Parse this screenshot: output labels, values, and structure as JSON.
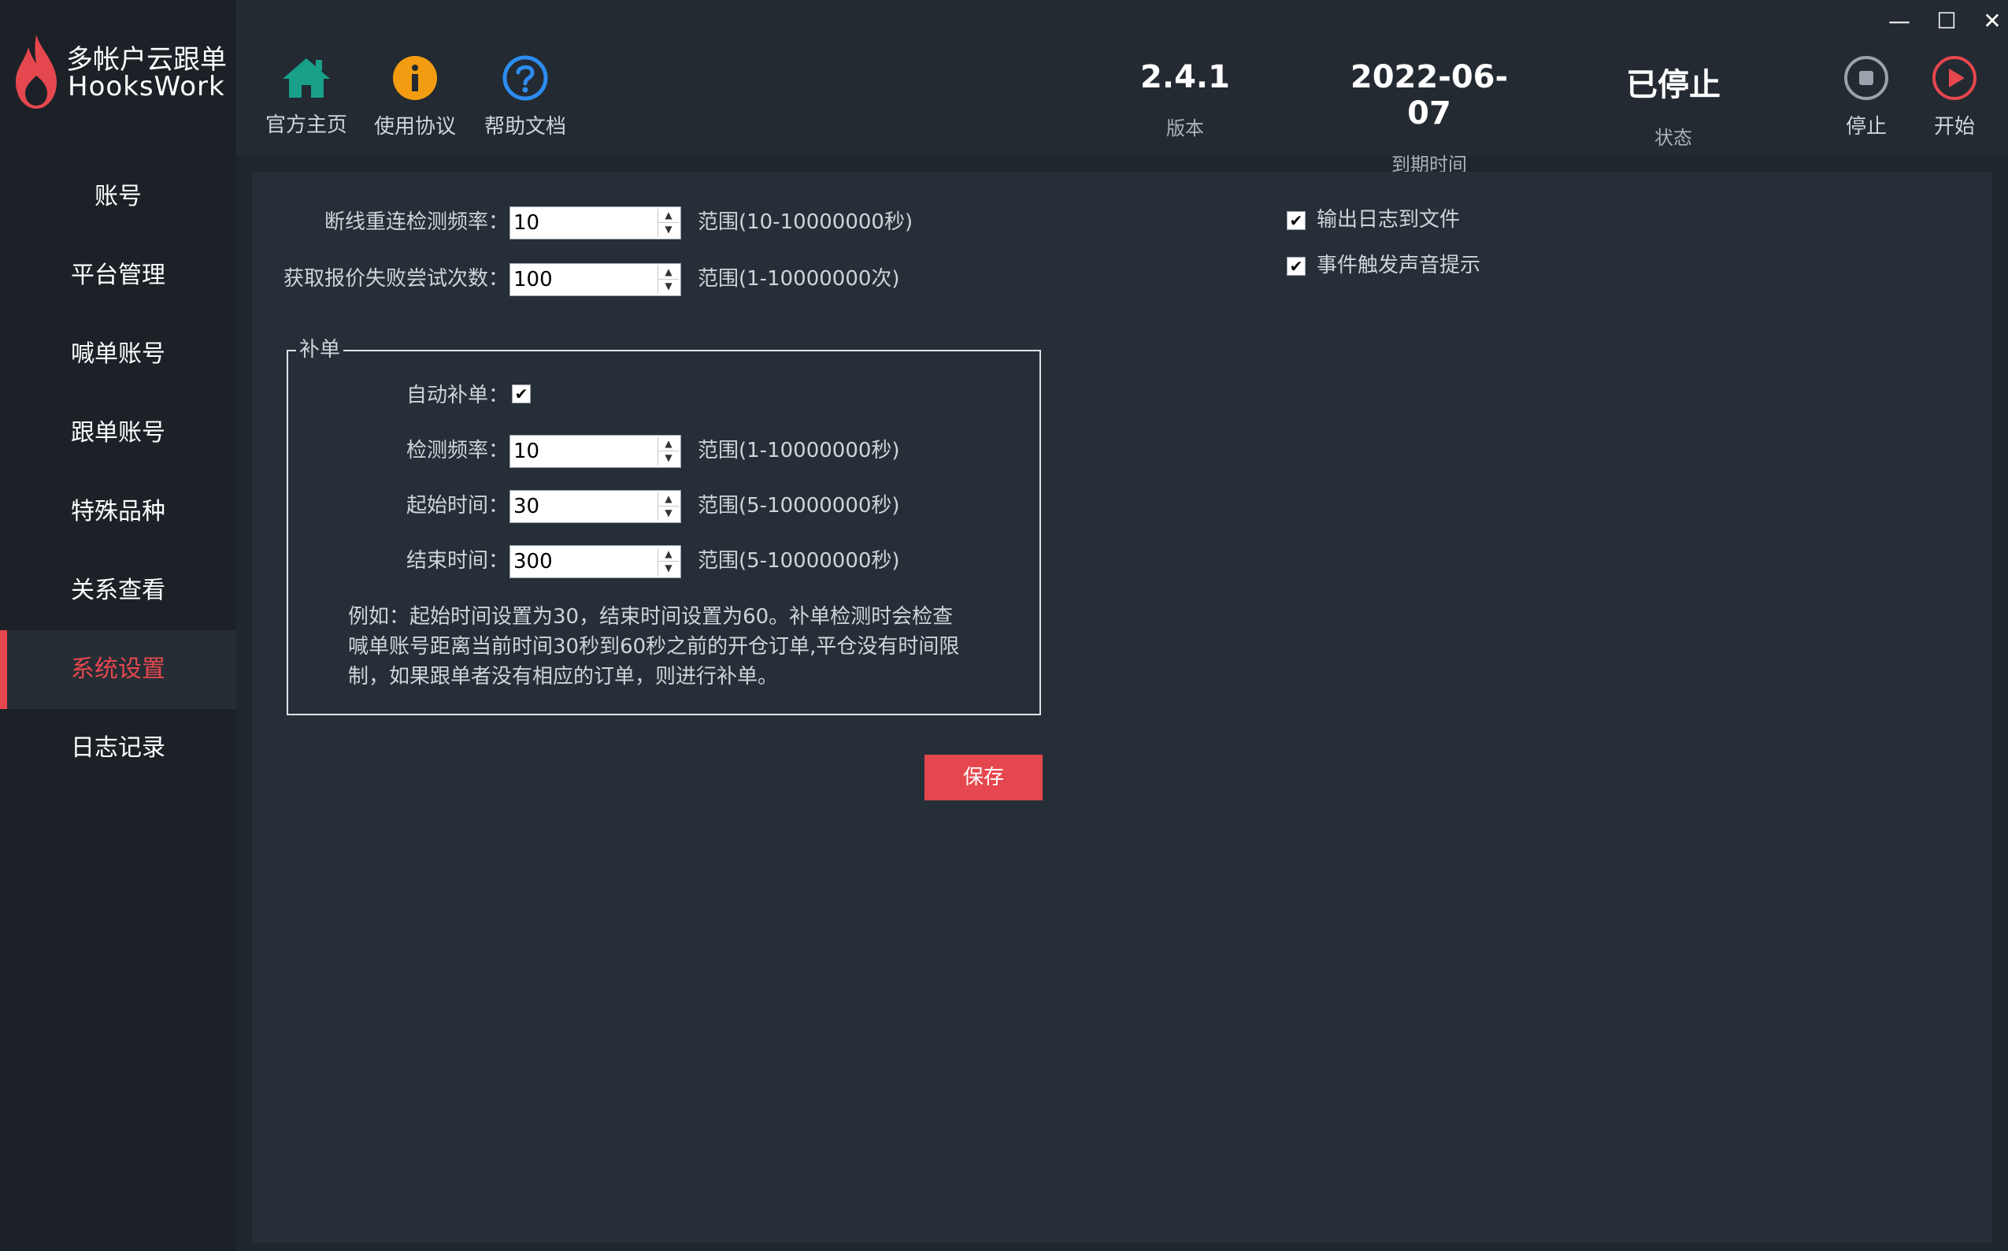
{
  "app": {
    "name_line1": "多帐户云跟单",
    "name_line2": "HooksWork"
  },
  "sidebar": {
    "items": [
      {
        "label": "账号"
      },
      {
        "label": "平台管理"
      },
      {
        "label": "喊单账号"
      },
      {
        "label": "跟单账号"
      },
      {
        "label": "特殊品种"
      },
      {
        "label": "关系查看"
      },
      {
        "label": "系统设置",
        "active": true
      },
      {
        "label": "日志记录"
      }
    ]
  },
  "toolbar": {
    "home_label": "官方主页",
    "agreement_label": "使用协议",
    "help_label": "帮助文档",
    "stop_label": "停止",
    "start_label": "开始"
  },
  "info": {
    "version_value": "2.4.1",
    "version_caption": "版本",
    "expiry_value": "2022-06-07",
    "expiry_caption": "到期时间",
    "status_value": "已停止",
    "status_caption": "状态"
  },
  "window": {
    "minimize": "—",
    "maximize": "☐",
    "close": "✕"
  },
  "settings": {
    "reconnect_label": "断线重连检测频率：",
    "reconnect_value": "10",
    "reconnect_range": "范围(10-10000000秒)",
    "retry_label": "获取报价失败尝试次数：",
    "retry_value": "100",
    "retry_range": "范围(1-10000000次)",
    "log_to_file_label": "输出日志到文件",
    "log_to_file_checked": true,
    "sound_label": "事件触发声音提示",
    "sound_checked": true
  },
  "supplement": {
    "title": "补单",
    "auto_label": "自动补单：",
    "auto_checked": true,
    "freq_label": "检测频率：",
    "freq_value": "10",
    "freq_range": "范围(1-10000000秒)",
    "start_label": "起始时间：",
    "start_value": "30",
    "start_range": "范围(5-10000000秒)",
    "end_label": "结束时间：",
    "end_value": "300",
    "end_range": "范围(5-10000000秒)",
    "note": "例如：起始时间设置为30，结束时间设置为60。补单检测时会检查喊单账号距离当前时间30秒到60秒之前的开仓订单,平仓没有时间限制，如果跟单者没有相应的订单，则进行补单。"
  },
  "save_label": "保存",
  "colors": {
    "accent": "#e5474e",
    "home_icon": "#18a08a",
    "info_icon": "#f39c12",
    "help_icon": "#2d8cf0"
  }
}
